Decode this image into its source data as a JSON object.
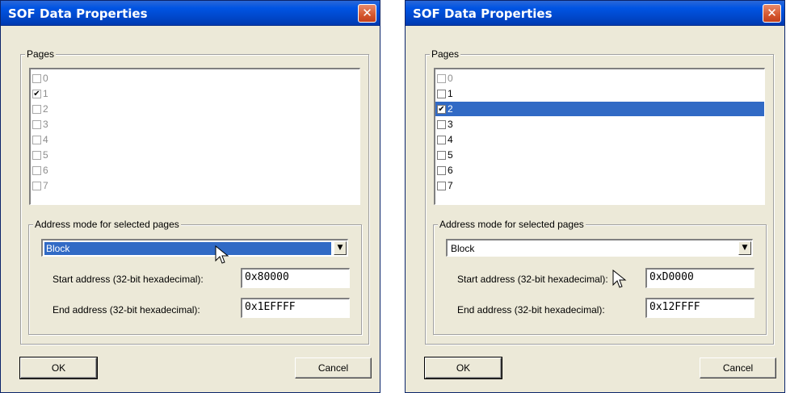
{
  "dialogs": [
    {
      "title": "SOF Data Properties",
      "close_icon": "close-icon",
      "pages_label": "Pages",
      "pages": [
        {
          "label": "0",
          "checked": false,
          "enabled": false,
          "selected": false
        },
        {
          "label": "1",
          "checked": true,
          "enabled": false,
          "selected": false
        },
        {
          "label": "2",
          "checked": false,
          "enabled": false,
          "selected": false
        },
        {
          "label": "3",
          "checked": false,
          "enabled": false,
          "selected": false
        },
        {
          "label": "4",
          "checked": false,
          "enabled": false,
          "selected": false
        },
        {
          "label": "5",
          "checked": false,
          "enabled": false,
          "selected": false
        },
        {
          "label": "6",
          "checked": false,
          "enabled": false,
          "selected": false
        },
        {
          "label": "7",
          "checked": false,
          "enabled": false,
          "selected": false
        }
      ],
      "address_mode_label": "Address mode for selected pages",
      "address_mode_value": "Block",
      "start_label": "Start address (32-bit hexadecimal):",
      "start_value": "0x80000",
      "end_label": "End address (32-bit hexadecimal):",
      "end_value": "0x1EFFFF",
      "ok_label": "OK",
      "cancel_label": "Cancel"
    },
    {
      "title": "SOF Data Properties",
      "close_icon": "close-icon",
      "pages_label": "Pages",
      "pages": [
        {
          "label": "0",
          "checked": false,
          "enabled": false,
          "selected": false
        },
        {
          "label": "1",
          "checked": false,
          "enabled": true,
          "selected": false
        },
        {
          "label": "2",
          "checked": true,
          "enabled": true,
          "selected": true
        },
        {
          "label": "3",
          "checked": false,
          "enabled": true,
          "selected": false
        },
        {
          "label": "4",
          "checked": false,
          "enabled": true,
          "selected": false
        },
        {
          "label": "5",
          "checked": false,
          "enabled": true,
          "selected": false
        },
        {
          "label": "6",
          "checked": false,
          "enabled": true,
          "selected": false
        },
        {
          "label": "7",
          "checked": false,
          "enabled": true,
          "selected": false
        }
      ],
      "address_mode_label": "Address mode for selected pages",
      "address_mode_value": "Block",
      "start_label": "Start address (32-bit hexadecimal):",
      "start_value": "0xD0000",
      "end_label": "End address (32-bit hexadecimal):",
      "end_value": "0x12FFFF",
      "ok_label": "OK",
      "cancel_label": "Cancel"
    }
  ],
  "colors": {
    "titlebar": "#0054e3",
    "selection": "#316ac5",
    "dialog_bg": "#ece9d8",
    "close_button": "#d5572e"
  }
}
